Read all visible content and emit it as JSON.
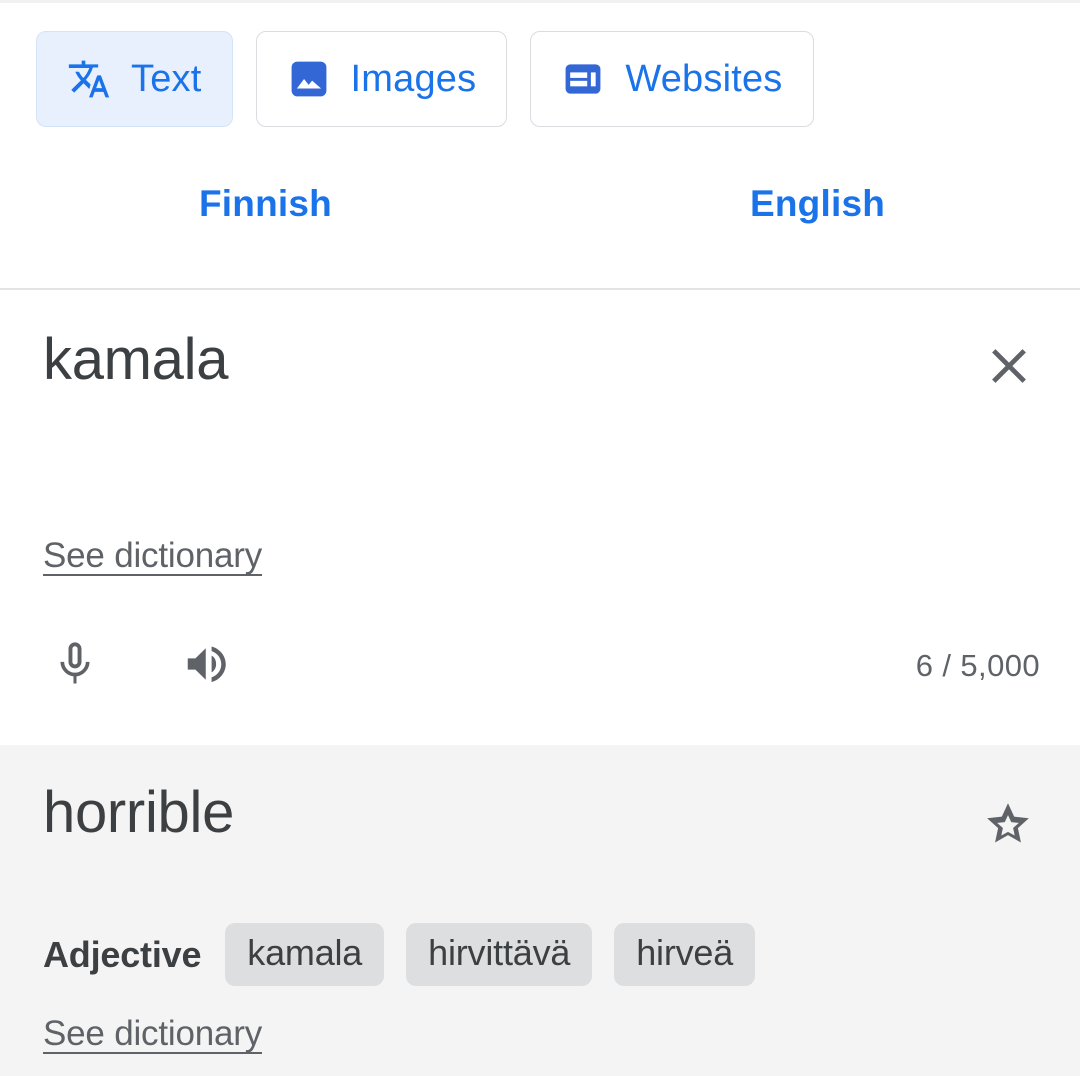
{
  "tabs": [
    {
      "label": "Text",
      "icon": "translate-icon",
      "active": true
    },
    {
      "label": "Images",
      "icon": "image-icon",
      "active": false
    },
    {
      "label": "Websites",
      "icon": "website-icon",
      "active": false
    }
  ],
  "languages": {
    "source": "Finnish",
    "target": "English",
    "swap_icon": "swap-horizontal-icon"
  },
  "source_panel": {
    "text": "kamala",
    "clear_icon": "close-icon",
    "dictionary_link": "See dictionary",
    "mic_icon": "microphone-icon",
    "speaker_icon": "volume-up-icon",
    "counter": "6 / 5,000"
  },
  "target_panel": {
    "text": "horrible",
    "star_icon": "star-outline-icon",
    "part_of_speech": "Adjective",
    "translations": [
      "kamala",
      "hirvittävä",
      "hirveä"
    ],
    "dictionary_link": "See dictionary"
  },
  "colors": {
    "accent_blue": "#1a73e8",
    "active_tab_bg": "#e8f0fe",
    "icon_gray": "#5f6368",
    "text_gray": "#3c4043",
    "result_bg": "#f4f4f4",
    "chip_bg": "#dcdee0"
  }
}
